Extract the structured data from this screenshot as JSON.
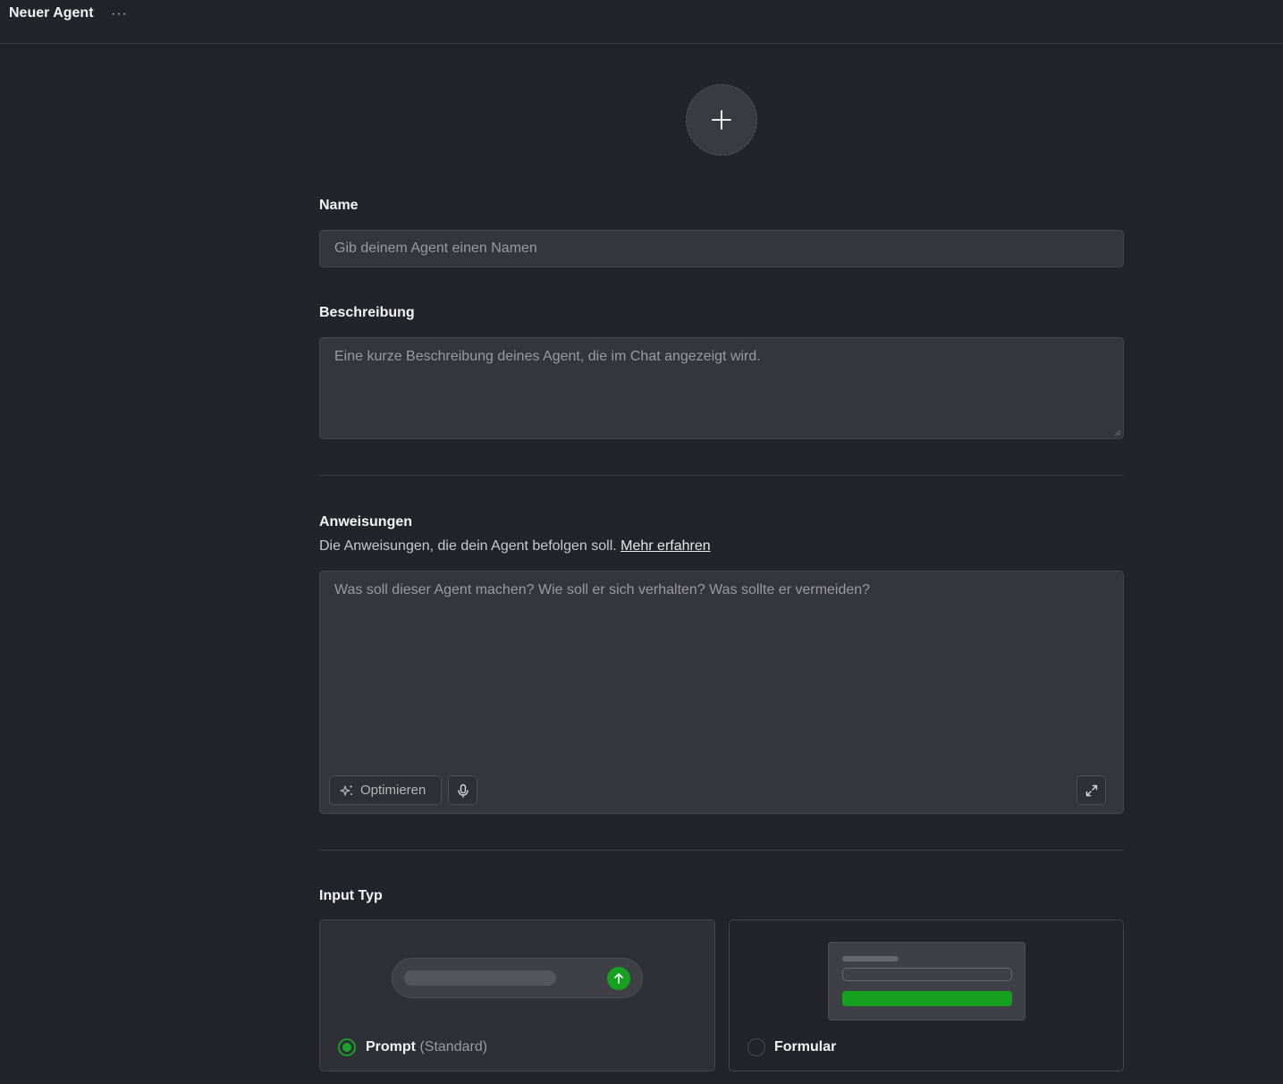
{
  "header": {
    "title": "Neuer Agent",
    "more_label": "···"
  },
  "avatar": {
    "icon": "plus-icon"
  },
  "name": {
    "label": "Name",
    "placeholder": "Gib deinem Agent einen Namen",
    "value": ""
  },
  "description": {
    "label": "Beschreibung",
    "placeholder": "Eine kurze Beschreibung deines Agent, die im Chat angezeigt wird.",
    "value": ""
  },
  "instructions": {
    "label": "Anweisungen",
    "subtitle": "Die Anweisungen, die dein Agent befolgen soll.",
    "link_label": "Mehr erfahren",
    "placeholder": "Was soll dieser Agent machen? Wie soll er sich verhalten? Was sollte er vermeiden?",
    "value": "",
    "optimize_label": "Optimieren",
    "mic_icon": "microphone-icon",
    "expand_icon": "expand-icon"
  },
  "input_type": {
    "label": "Input Typ",
    "options": [
      {
        "label": "Prompt",
        "note": "(Standard)",
        "selected": true
      },
      {
        "label": "Formular",
        "note": "",
        "selected": false
      }
    ]
  },
  "colors": {
    "accent": "#1aa52c",
    "background": "#232429",
    "field": "#35363c"
  }
}
